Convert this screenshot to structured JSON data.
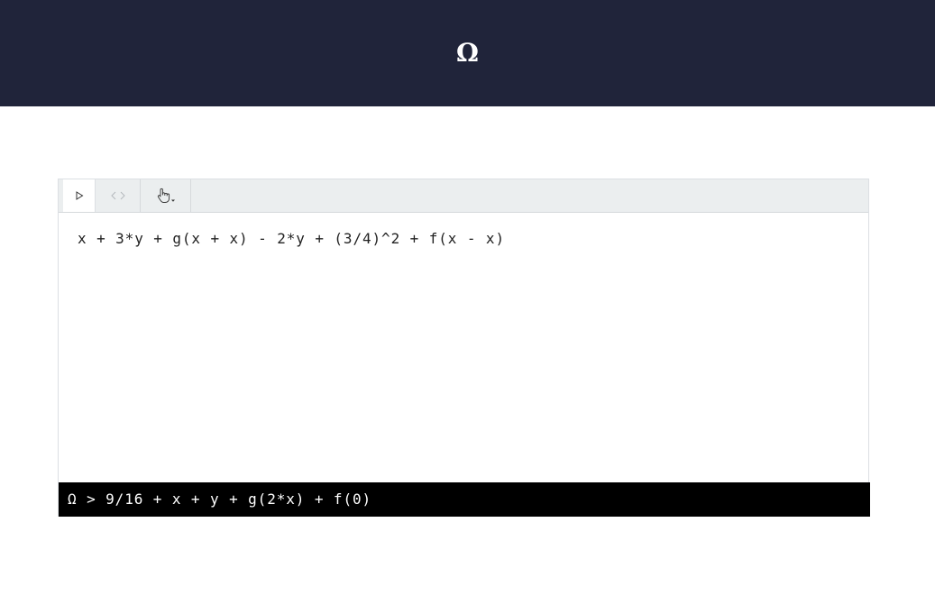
{
  "header": {
    "logo": "Ω"
  },
  "toolbar": {
    "run_icon": "play-icon",
    "code_icon": "code-icon",
    "pointer_icon": "hand-pointer-icon"
  },
  "editor": {
    "code": "x + 3*y + g(x + x) - 2*y + (3/4)^2 + f(x - x)"
  },
  "output": {
    "prompt": "Ω > ",
    "result": "9/16 + x + y + g(2*x) + f(0)"
  },
  "colors": {
    "header_bg": "#20243a",
    "toolbar_bg": "#ebeeef",
    "output_bg": "#000000"
  }
}
